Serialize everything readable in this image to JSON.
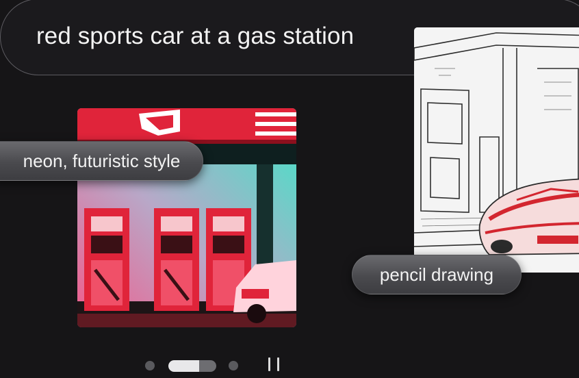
{
  "prompt": {
    "text": "red sports car at a gas station"
  },
  "styles": [
    {
      "label": "neon, futuristic style"
    },
    {
      "label": "pencil drawing"
    }
  ],
  "carousel": {
    "slide_count": 3,
    "active_index": 1,
    "pause_icon": "pause-icon"
  },
  "colors": {
    "background": "#161517",
    "chip": "#58585c",
    "neon_red": "#e0243a",
    "neon_teal": "#4fe0c9"
  }
}
